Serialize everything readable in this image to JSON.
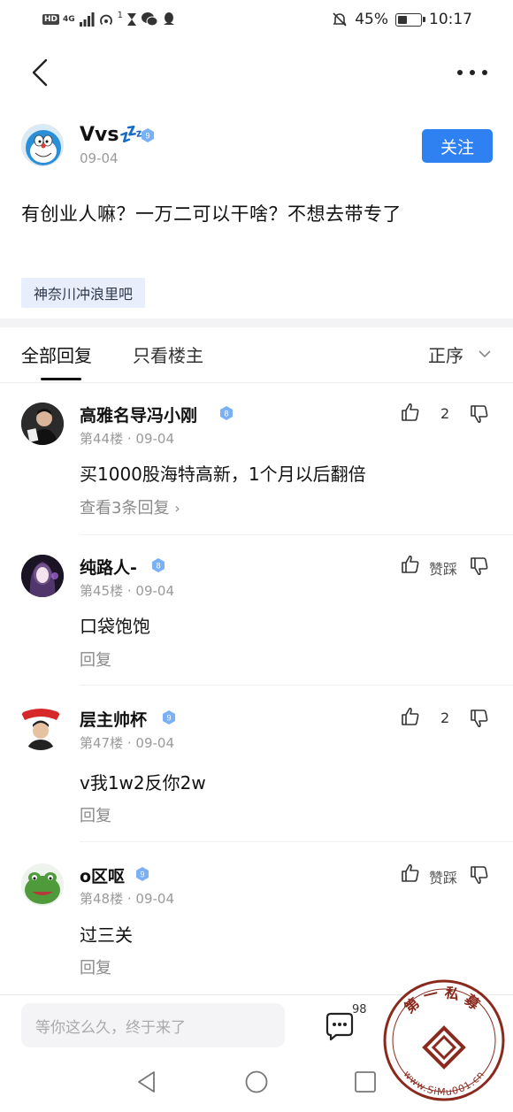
{
  "status_bar": {
    "network_left": "HD",
    "network_type": "4G",
    "network_sub": "1",
    "battery_percent": "45%",
    "battery_level": 0.45,
    "time": "10:17"
  },
  "post": {
    "author": "Vvs💤",
    "level": "9",
    "date": "09-04",
    "follow_label": "关注",
    "text": "有创业人嘛？一万二可以干啥？不想去带专了",
    "forum_tag": "神奈川冲浪里吧"
  },
  "tabs": {
    "all": "全部回复",
    "op_only": "只看楼主",
    "sort": "正序"
  },
  "replies": [
    {
      "name": "高雅名导冯小刚",
      "level": "8",
      "floor": "第44楼",
      "date": "09-04",
      "content": "买1000股海特高新，1个月以后翻倍",
      "action": "查看3条回复",
      "like": "2"
    },
    {
      "name": "纯路人-",
      "level": "8",
      "floor": "第45楼",
      "date": "09-04",
      "content": "口袋饱饱",
      "action": "回复",
      "like": "赞踩"
    },
    {
      "name": "层主帅杯",
      "level": "9",
      "floor": "第47楼",
      "date": "09-04",
      "content": "v我1w2反你2w",
      "action": "回复",
      "like": "2"
    },
    {
      "name": "o区呕",
      "level": "9",
      "floor": "第48楼",
      "date": "09-04",
      "content": "过三关",
      "action": "回复",
      "like": "赞踩"
    }
  ],
  "bottom_bar": {
    "input_placeholder": "等你这么久，终于来了",
    "comment_count": "98"
  },
  "watermark": {
    "text": "第一私募",
    "url": "www.SiMu001.cn"
  },
  "colors": {
    "accent": "#2f80f0",
    "badge": "#7ab0f5",
    "tag_bg": "#e8eefb"
  }
}
